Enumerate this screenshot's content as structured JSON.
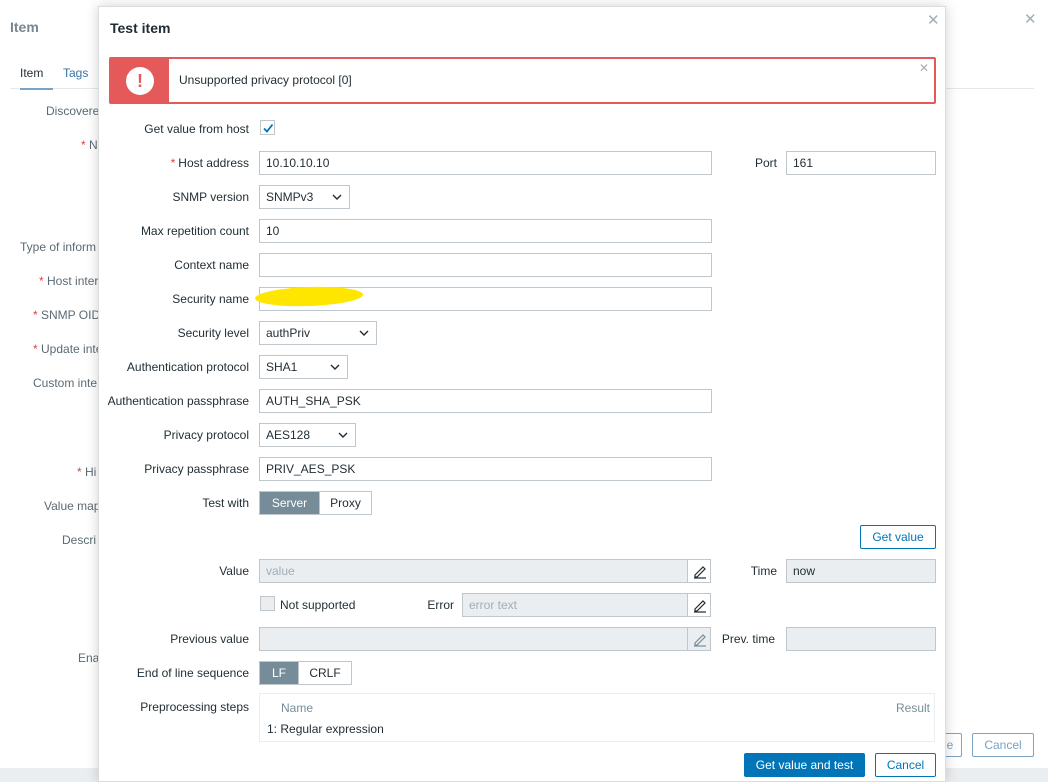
{
  "background": {
    "title": "Item",
    "tabs": [
      "Item",
      "Tags"
    ],
    "labels": {
      "discovered": "Discovere",
      "name": "N",
      "type_of_info": "Type of inform",
      "host_interface": "Host inter",
      "snmp_oid": "SNMP OID",
      "update_interval": "Update inte",
      "custom_intervals": "Custom inte",
      "history": "Hi",
      "value_mapping": "Value map",
      "description": "Descri",
      "enabled": "Ena"
    },
    "cancel_label": "Cancel",
    "partial_button_label": "e"
  },
  "modal": {
    "title": "Test item",
    "error": {
      "message": "Unsupported privacy protocol [0]",
      "icon": "!"
    },
    "fields": {
      "get_value_from_host": {
        "label": "Get value from host",
        "checked": true
      },
      "host_address": {
        "label": "Host address",
        "value": "10.10.10.10",
        "required": true
      },
      "port": {
        "label": "Port",
        "value": "161"
      },
      "snmp_version": {
        "label": "SNMP version",
        "value": "SNMPv3"
      },
      "max_repetition": {
        "label": "Max repetition count",
        "value": "10"
      },
      "context_name": {
        "label": "Context name",
        "value": ""
      },
      "security_name": {
        "label": "Security name",
        "value": ""
      },
      "security_level": {
        "label": "Security level",
        "value": "authPriv"
      },
      "auth_protocol": {
        "label": "Authentication protocol",
        "value": "SHA1"
      },
      "auth_passphrase": {
        "label": "Authentication passphrase",
        "value": "AUTH_SHA_PSK"
      },
      "privacy_protocol": {
        "label": "Privacy protocol",
        "value": "AES128"
      },
      "privacy_passphrase": {
        "label": "Privacy passphrase",
        "value": "PRIV_AES_PSK"
      },
      "test_with": {
        "label": "Test with",
        "options": [
          "Server",
          "Proxy"
        ],
        "selected": "Server"
      }
    },
    "get_value_button": "Get value",
    "results": {
      "value": {
        "label": "Value",
        "placeholder": "value"
      },
      "time": {
        "label": "Time",
        "value": "now"
      },
      "not_supported": {
        "label": "Not supported",
        "checked": false
      },
      "error": {
        "label": "Error",
        "placeholder": "error text"
      },
      "previous_value": {
        "label": "Previous value",
        "value": ""
      },
      "prev_time": {
        "label": "Prev. time",
        "value": ""
      },
      "eol": {
        "label": "End of line sequence",
        "options": [
          "LF",
          "CRLF"
        ],
        "selected": "LF"
      }
    },
    "preprocessing": {
      "label": "Preprocessing steps",
      "columns": [
        "Name",
        "Result"
      ],
      "steps": [
        {
          "index": "1:",
          "name": "Regular expression"
        }
      ]
    },
    "footer": {
      "test_button": "Get value and test",
      "cancel_button": "Cancel"
    },
    "colors": {
      "accent": "#0275b8",
      "error": "#e45959",
      "segment_on": "#768d99",
      "redaction": "#ffe600"
    }
  }
}
